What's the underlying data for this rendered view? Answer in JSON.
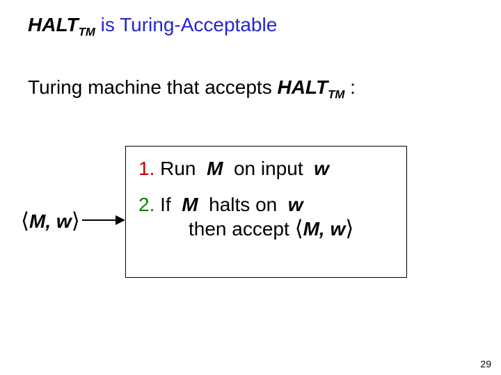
{
  "title": {
    "halt": "HALT",
    "tm_sub": "TM",
    "rest": " is Turing-Acceptable"
  },
  "line2": {
    "prefix": "Turing machine that accepts ",
    "halt": "HALT",
    "tm_sub": "TM",
    "suffix": " :"
  },
  "input_tuple": {
    "open": "⟨",
    "m": "M",
    "comma": ", ",
    "w": "w",
    "close": "⟩"
  },
  "box": {
    "step1": {
      "num": "1.",
      "run": " Run ",
      "m": "M",
      "oninput": " on input ",
      "w": "w"
    },
    "step2": {
      "num": "2.",
      "iftxt": " If ",
      "m": "M",
      "halts_on": " halts on ",
      "w": "w",
      "then_accept": "then accept ",
      "open": "⟨",
      "tm": "M",
      "comma": ", ",
      "tw": "w",
      "close": "⟩"
    }
  },
  "page_number": "29"
}
